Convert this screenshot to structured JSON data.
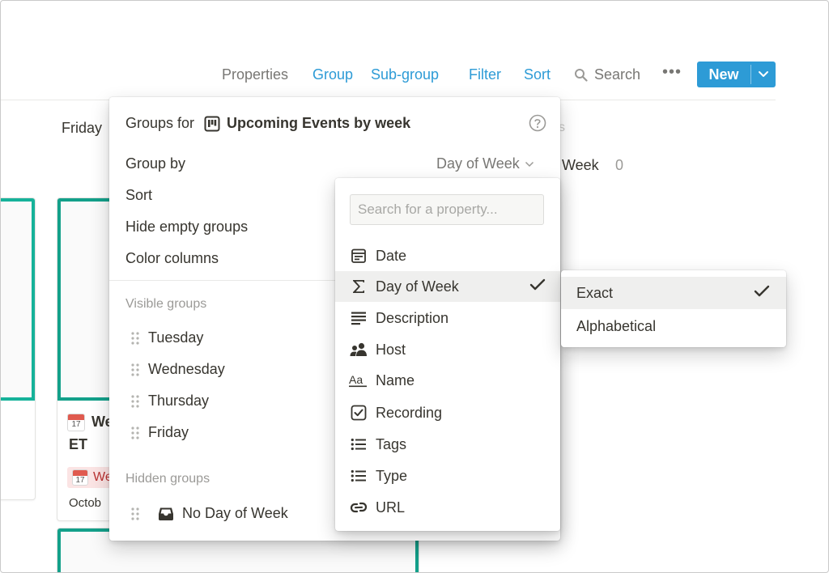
{
  "toolbar": {
    "properties": "Properties",
    "group": "Group",
    "sub_group": "Sub-group",
    "filter": "Filter",
    "sort": "Sort",
    "search": "Search",
    "more": "•••",
    "new": "New"
  },
  "board": {
    "col_friday": "Friday",
    "col_no_week": "Week",
    "col_no_week_count": "0",
    "faint_label": "s",
    "card": {
      "title_line1": "We",
      "title_line2": "ET",
      "tag": "We",
      "date": "Octob",
      "calendar_day": "17"
    }
  },
  "groups_panel": {
    "title_prefix": "Groups for",
    "database_name": "Upcoming Events by week",
    "group_by_label": "Group by",
    "group_by_value": "Day of Week",
    "sort_label": "Sort",
    "hide_empty_label": "Hide empty groups",
    "color_columns_label": "Color columns",
    "visible_section": "Visible groups",
    "visible_groups": [
      "Tuesday",
      "Wednesday",
      "Thursday",
      "Friday"
    ],
    "hidden_section": "Hidden groups",
    "hidden_groups": [
      "No Day of Week"
    ]
  },
  "property_menu": {
    "search_placeholder": "Search for a property...",
    "items": [
      {
        "label": "Date",
        "icon": "calendar-icon"
      },
      {
        "label": "Day of Week",
        "icon": "sigma-icon",
        "selected": true
      },
      {
        "label": "Description",
        "icon": "text-icon"
      },
      {
        "label": "Host",
        "icon": "person-icon"
      },
      {
        "label": "Name",
        "icon": "title-icon"
      },
      {
        "label": "Recording",
        "icon": "checkbox-icon"
      },
      {
        "label": "Tags",
        "icon": "list-icon"
      },
      {
        "label": "Type",
        "icon": "list-icon"
      },
      {
        "label": "URL",
        "icon": "link-icon"
      }
    ]
  },
  "sub_menu": {
    "items": [
      {
        "label": "Exact",
        "selected": true
      },
      {
        "label": "Alphabetical",
        "selected": false
      }
    ]
  },
  "colors": {
    "accent": "#2d9bd6",
    "muted": "#787774",
    "card_border": "#13a08a"
  }
}
